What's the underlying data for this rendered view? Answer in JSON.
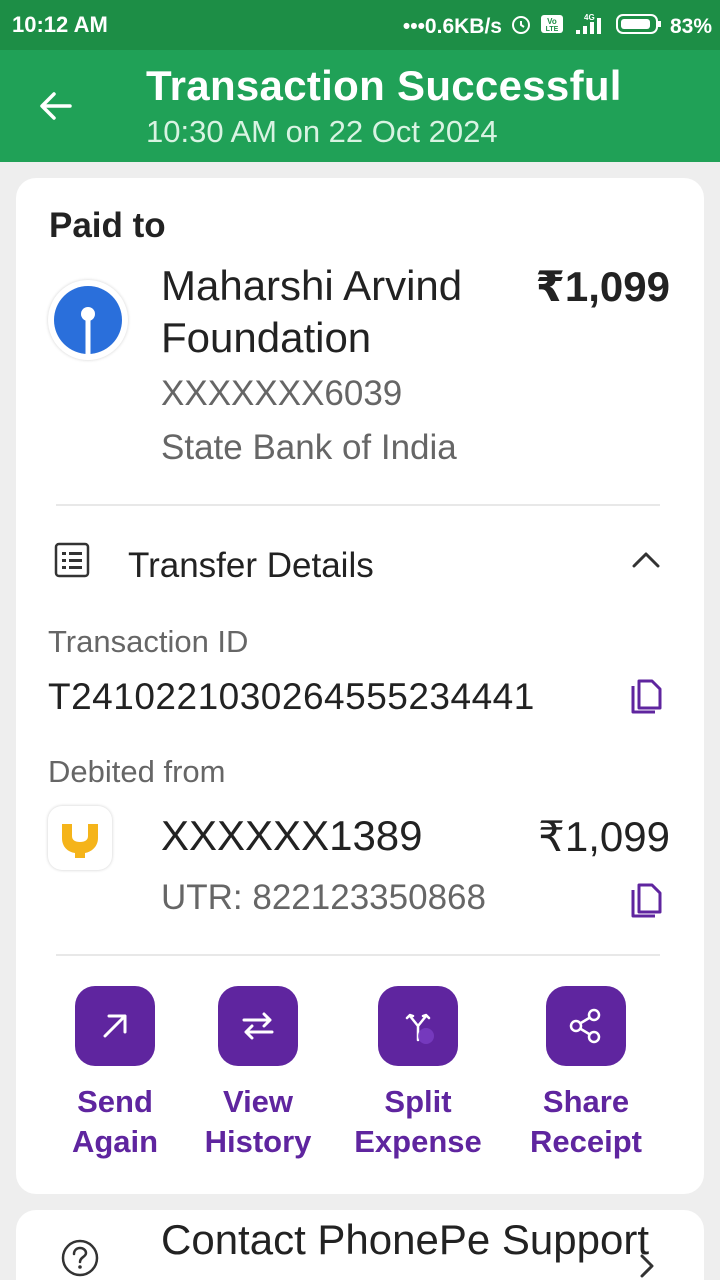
{
  "status_bar": {
    "time": "10:12 AM",
    "network_speed": "•••0.6KB/s",
    "network_type": "4G",
    "battery": "83%"
  },
  "header": {
    "title": "Transaction Successful",
    "subtitle": "10:30 AM on 22 Oct 2024"
  },
  "payee": {
    "section_label": "Paid to",
    "name": "Maharshi Arvind Foundation",
    "amount": "₹1,099",
    "account": "XXXXXXX6039",
    "bank": "State Bank of India"
  },
  "transfer_details": {
    "label": "Transfer Details",
    "transaction_id_label": "Transaction ID",
    "transaction_id": "T2410221030264555234441",
    "debited_from_label": "Debited from",
    "debit_account": "XXXXXX1389",
    "debit_amount": "₹1,099",
    "utr": "UTR: 822123350868"
  },
  "actions": [
    {
      "line1": "Send",
      "line2": "Again",
      "icon": "arrow-up-right-icon"
    },
    {
      "line1": "View",
      "line2": "History",
      "icon": "swap-arrows-icon"
    },
    {
      "line1": "Split",
      "line2": "Expense",
      "icon": "split-icon"
    },
    {
      "line1": "Share",
      "line2": "Receipt",
      "icon": "share-icon"
    }
  ],
  "support": {
    "title": "Contact PhonePe Support"
  },
  "colors": {
    "header_green": "#20a157",
    "statusbar_green": "#1d8e46",
    "brand_purple": "#5f259f",
    "sbi_blue": "#2a6fdb",
    "pnb_yellow": "#f5b41a"
  }
}
